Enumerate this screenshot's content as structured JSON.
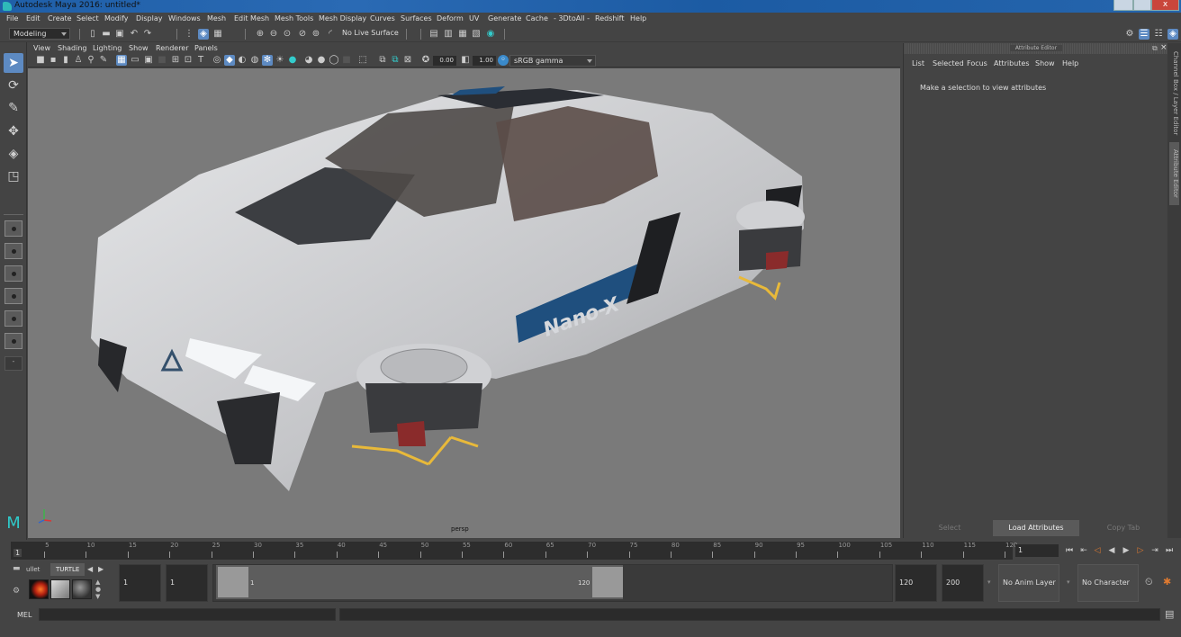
{
  "window": {
    "title": "Autodesk Maya 2016: untitled*",
    "controls": {
      "minimize": "—",
      "maximize": "□",
      "close": "x"
    }
  },
  "menubar": {
    "items": [
      "File",
      "Edit",
      "Create",
      "Select",
      "Modify",
      "Display",
      "Windows",
      "Mesh",
      "Edit Mesh",
      "Mesh Tools",
      "Mesh Display",
      "Curves",
      "Surfaces",
      "Deform",
      "UV",
      "Generate",
      "Cache",
      "- 3DtoAll -",
      "Redshift",
      "Help"
    ]
  },
  "statusline": {
    "menuset": "Modeling",
    "live_surface": "No Live Surface",
    "icons": [
      "new-scene-icon",
      "open-scene-icon",
      "save-scene-icon",
      "undo-icon",
      "redo-icon",
      "select-by-hierarchy-icon",
      "select-by-object-icon",
      "select-by-component-icon",
      "snap-grid-icon",
      "snap-curve-icon",
      "snap-point-icon",
      "snap-projected-icon",
      "snap-view-plane-icon",
      "make-live-icon",
      "render-frame-icon",
      "ipr-render-icon",
      "render-settings-icon",
      "hypershade-icon",
      "redshift-icon"
    ],
    "right_icons": [
      "modeling-toolkit-icon",
      "attribute-editor-toggle-icon",
      "tool-settings-icon",
      "channel-box-icon"
    ]
  },
  "toolbox": {
    "tools": [
      "select-tool",
      "lasso-tool",
      "paint-select-tool",
      "move-tool",
      "rotate-tool",
      "scale-tool"
    ],
    "layouts": [
      "single-view-layout",
      "four-view-layout",
      "two-pane-side-layout",
      "two-pane-stacked-layout",
      "outliner-persp-layout",
      "graph-persp-layout",
      "custom-layout"
    ]
  },
  "viewport": {
    "panel_menu": [
      "View",
      "Shading",
      "Lighting",
      "Show",
      "Renderer",
      "Panels"
    ],
    "exposure": "0.00",
    "gamma": "1.00",
    "color_space": "sRGB gamma",
    "camera": "persp",
    "model_label": "Nano-X",
    "colors": {
      "car_body": "#c9cacc",
      "stripe": "#1f4f7e",
      "accent_yellow": "#e8b93a",
      "taillight_red": "#b33a33"
    }
  },
  "attribute_editor": {
    "title": "Attribute Editor",
    "menu": [
      "List",
      "Selected",
      "Focus",
      "Attributes",
      "Show",
      "Help"
    ],
    "hint": "Make a selection to view attributes",
    "buttons": {
      "select": "Select",
      "load": "Load Attributes",
      "copy_tab": "Copy Tab"
    },
    "side_tabs": [
      "Channel Box / Layer Editor",
      "Attribute Editor"
    ]
  },
  "timeline": {
    "ticks": [
      "5",
      "10",
      "15",
      "20",
      "25",
      "30",
      "35",
      "40",
      "45",
      "50",
      "55",
      "60",
      "65",
      "70",
      "75",
      "80",
      "85",
      "90",
      "95",
      "100",
      "105",
      "110",
      "115",
      "120"
    ],
    "start_label": "1",
    "current_frame": "1",
    "playback_buttons": [
      "go-to-start",
      "step-back-key",
      "step-back-frame",
      "play-backwards",
      "play-forwards",
      "step-forward-frame",
      "step-forward-key",
      "go-to-end"
    ]
  },
  "range": {
    "shelf_tabs": [
      "ullet",
      "TURTLE"
    ],
    "start_time": "1",
    "playback_start": "1",
    "range_start_label": "1",
    "range_end_label": "120",
    "playback_end": "120",
    "end_time": "200",
    "anim_layer": "No Anim Layer",
    "character_set": "No Character Set"
  },
  "command_line": {
    "label": "MEL"
  }
}
